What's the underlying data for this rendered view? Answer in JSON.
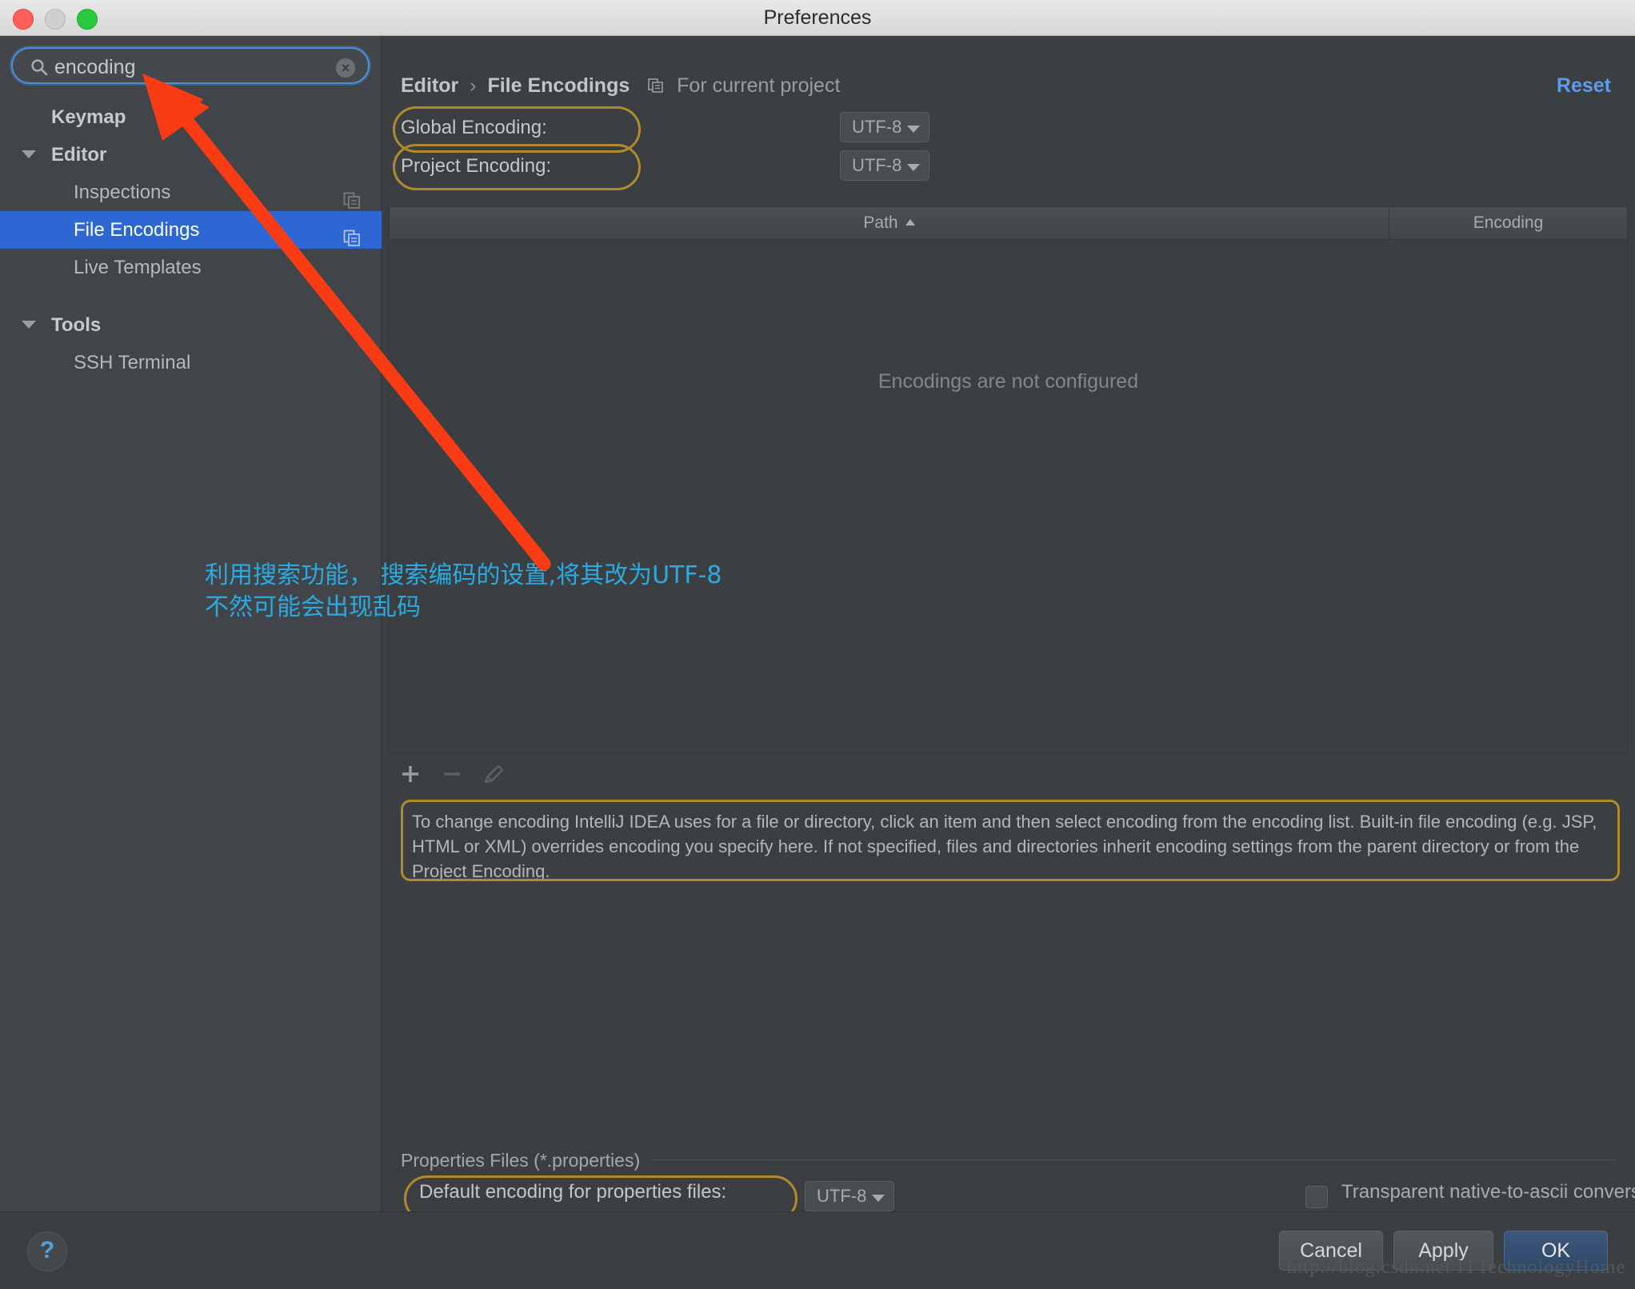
{
  "window": {
    "title": "Preferences"
  },
  "search": {
    "value": "encoding",
    "placeholder": "Search",
    "icon": "search-icon",
    "clear_glyph": "×"
  },
  "sidebar": {
    "items": [
      {
        "label": "Keymap",
        "level": 0,
        "group": true,
        "expandable": false,
        "selected": false,
        "copy_icon": false
      },
      {
        "label": "Editor",
        "level": 0,
        "group": true,
        "expandable": true,
        "selected": false,
        "copy_icon": false
      },
      {
        "label": "Inspections",
        "level": 1,
        "group": false,
        "expandable": false,
        "selected": false,
        "copy_icon": true
      },
      {
        "label": "File Encodings",
        "level": 1,
        "group": false,
        "expandable": false,
        "selected": true,
        "copy_icon": true
      },
      {
        "label": "Live Templates",
        "level": 1,
        "group": false,
        "expandable": false,
        "selected": false,
        "copy_icon": false
      },
      {
        "label": "Tools",
        "level": 0,
        "group": true,
        "expandable": true,
        "selected": false,
        "copy_icon": false
      },
      {
        "label": "SSH Terminal",
        "level": 1,
        "group": false,
        "expandable": false,
        "selected": false,
        "copy_icon": false
      }
    ]
  },
  "header": {
    "crumb_1": "Editor",
    "separator": "›",
    "crumb_2": "File Encodings",
    "scope_label": "For current project",
    "scope_icon": "project-scope-icon",
    "reset_label": "Reset"
  },
  "encodings": {
    "global_label": "Global Encoding:",
    "global_value": "UTF-8",
    "project_label": "Project Encoding:",
    "project_value": "UTF-8"
  },
  "table": {
    "col_path": "Path",
    "col_encoding": "Encoding",
    "sort_indicator": "ascending",
    "empty_message": "Encodings are not configured",
    "rows": []
  },
  "toolbar": {
    "add_label": "+",
    "remove_label": "−",
    "edit_label": "edit-pencil-icon"
  },
  "description": "To change encoding IntelliJ IDEA uses for a file or directory, click an item and then select encoding from the encoding list. Built-in file encoding (e.g. JSP, HTML or XML) overrides encoding you specify here. If not specified, files and directories inherit encoding settings from the parent directory or from the Project Encoding.",
  "properties": {
    "group_title": "Properties Files (*.properties)",
    "default_encoding_label": "Default encoding for properties files:",
    "default_encoding_value": "UTF-8",
    "transparent_checkbox_label": "Transparent native-to-ascii conversion",
    "transparent_checked": false
  },
  "footer": {
    "help_glyph": "?",
    "cancel_label": "Cancel",
    "apply_label": "Apply",
    "ok_label": "OK"
  },
  "annotation": {
    "line1": "利用搜索功能， 搜索编码的设置,将其改为UTF-8",
    "line2": "不然可能会出现乱码",
    "color": "#29abe2",
    "arrow_color": "#fa3c14"
  },
  "watermark": {
    "text": "http://blog.csdn.net/ITTechnologyHome"
  },
  "colors": {
    "selection_blue": "#2d67d4",
    "accent_link": "#5d9bec",
    "highlight_gold": "#b08a2e",
    "panel_bg": "#3c3f41",
    "sidebar_bg": "#41454a"
  }
}
